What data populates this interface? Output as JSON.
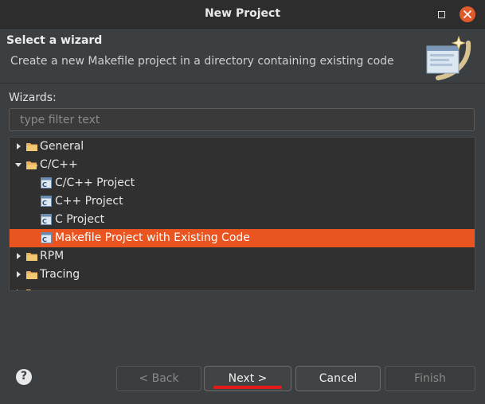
{
  "window": {
    "title": "New Project"
  },
  "header": {
    "heading": "Select a wizard",
    "description": "Create a new Makefile project in a directory containing existing code"
  },
  "wizards": {
    "label": "Wizards:",
    "filter_placeholder": "type filter text",
    "filter_value": ""
  },
  "tree": {
    "items": [
      {
        "label": "General",
        "type": "folder",
        "expanded": false,
        "depth": 0
      },
      {
        "label": "C/C++",
        "type": "folder",
        "expanded": true,
        "depth": 0
      },
      {
        "label": "C/C++ Project",
        "type": "project",
        "depth": 1
      },
      {
        "label": "C++ Project",
        "type": "project",
        "depth": 1
      },
      {
        "label": "C Project",
        "type": "project",
        "depth": 1
      },
      {
        "label": "Makefile Project with Existing Code",
        "type": "project",
        "depth": 1,
        "selected": true
      },
      {
        "label": "RPM",
        "type": "folder",
        "expanded": false,
        "depth": 0
      },
      {
        "label": "Tracing",
        "type": "folder",
        "expanded": false,
        "depth": 0
      }
    ]
  },
  "buttons": {
    "help_label": "?",
    "back_label": "< Back",
    "next_label": "Next >",
    "cancel_label": "Cancel",
    "finish_label": "Finish"
  },
  "colors": {
    "selection": "#e95420",
    "close_button": "#e05b2b",
    "annotation_underline": "#e31a1a",
    "folder": "#e8b35a"
  },
  "icons": {
    "folder": "folder-icon",
    "project": "c-project-icon",
    "help": "help-icon",
    "close": "close-icon",
    "maximize": "maximize-icon"
  }
}
